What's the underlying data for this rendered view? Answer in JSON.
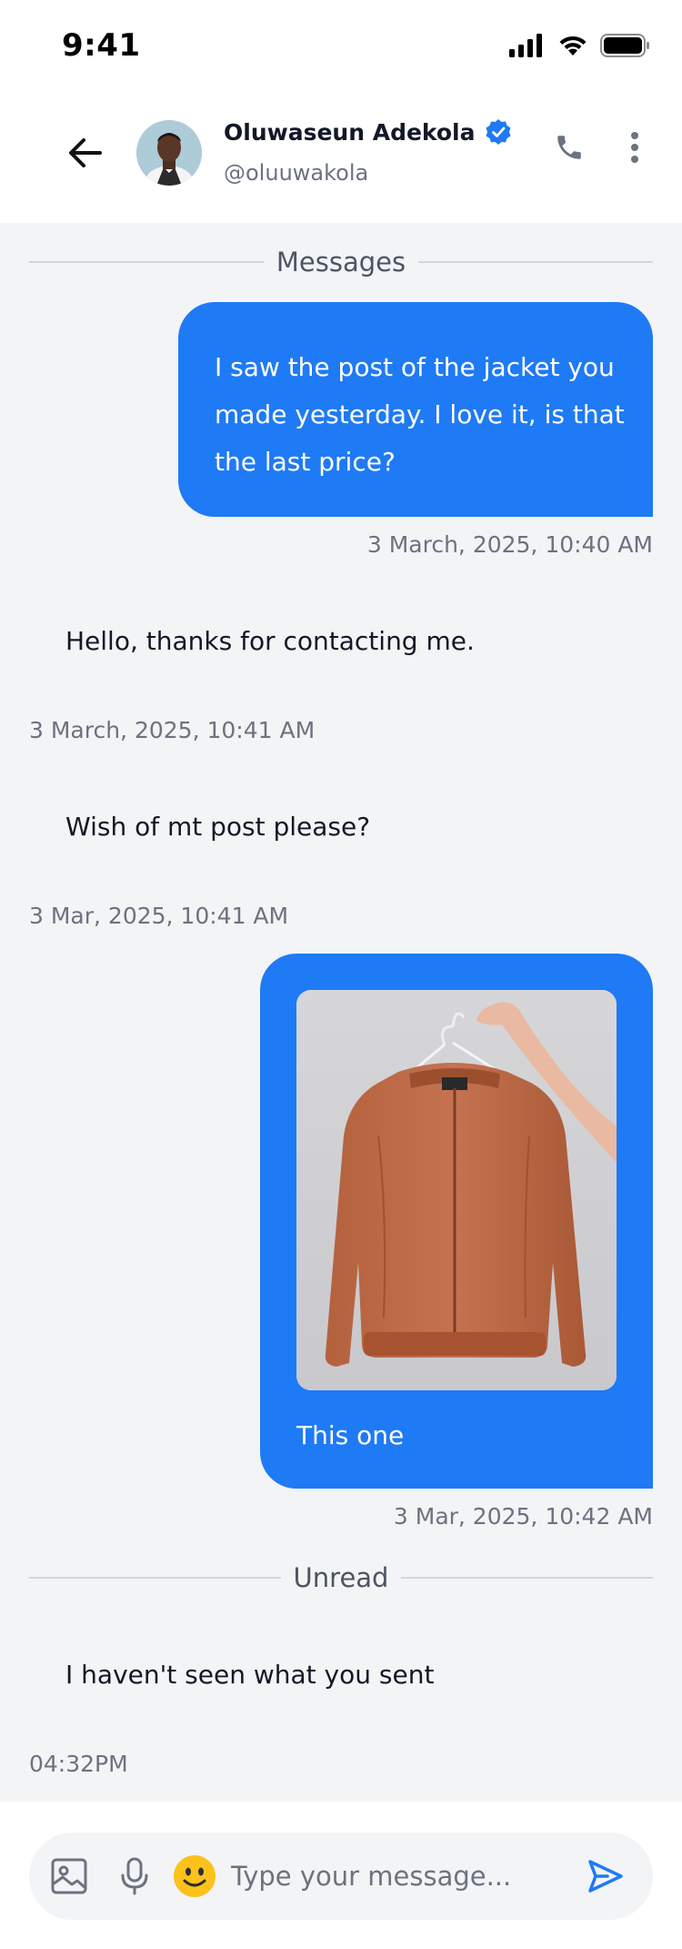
{
  "status_bar": {
    "time": "9:41"
  },
  "header": {
    "contact_name": "Oluwaseun Adekola",
    "contact_handle": "@oluuwakola",
    "verified": true
  },
  "chat": {
    "section_messages": "Messages",
    "msg1": {
      "text": "I saw the post of the jacket you made yesterday. I love it, is that the last price?",
      "timestamp": "3 March, 2025, 10:40 AM"
    },
    "msg2": {
      "text": "Hello, thanks for contacting me.",
      "timestamp": "3 March, 2025, 10:41 AM"
    },
    "msg3": {
      "text": "Wish of mt post please?",
      "timestamp": "3 Mar, 2025, 10:41 AM"
    },
    "msg4": {
      "caption": "This one",
      "timestamp": "3 Mar, 2025, 10:42 AM",
      "image": "jacket-photo"
    },
    "section_unread": "Unread",
    "msg5": {
      "text": "I haven't seen what you sent",
      "timestamp": "04:32PM"
    }
  },
  "composer": {
    "placeholder": "Type your message...",
    "value": ""
  },
  "colors": {
    "accent": "#1f7af5",
    "background": "#f3f4f6",
    "verified_badge": "#1f7af5"
  },
  "icons": [
    "back-arrow-icon",
    "verified-badge-icon",
    "phone-icon",
    "more-vertical-icon",
    "image-icon",
    "microphone-icon",
    "emoji-icon",
    "send-icon"
  ]
}
